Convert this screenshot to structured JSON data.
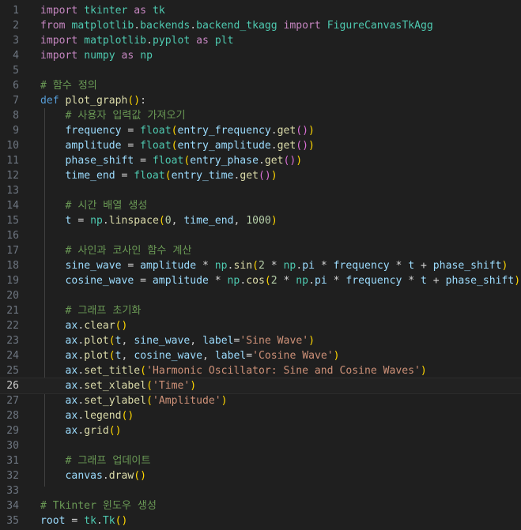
{
  "editor": {
    "language": "python",
    "current_line": 26,
    "colors": {
      "background": "#1f1f1f",
      "line_number": "#6e7681",
      "keyword_import": "#c586c0",
      "keyword_def": "#569cd6",
      "function": "#dcdcaa",
      "variable": "#9cdcfe",
      "module": "#4ec9b0",
      "comment": "#6a9955",
      "number": "#b5cea8",
      "string": "#ce9178",
      "bracket_1": "#ffd700",
      "bracket_2": "#da70d6",
      "bracket_3": "#179fff"
    },
    "lines": [
      {
        "n": "1",
        "tokens": [
          [
            "import",
            "kw"
          ],
          [
            " ",
            ""
          ],
          [
            "tkinter",
            "cls"
          ],
          [
            " ",
            ""
          ],
          [
            "as",
            "kw"
          ],
          [
            " ",
            ""
          ],
          [
            "tk",
            "cls"
          ]
        ]
      },
      {
        "n": "2",
        "tokens": [
          [
            "from",
            "kw"
          ],
          [
            " ",
            ""
          ],
          [
            "matplotlib",
            "cls"
          ],
          [
            ".",
            ""
          ],
          [
            "backends",
            "cls"
          ],
          [
            ".",
            ""
          ],
          [
            "backend_tkagg",
            "cls"
          ],
          [
            " ",
            ""
          ],
          [
            "import",
            "kw"
          ],
          [
            " ",
            ""
          ],
          [
            "FigureCanvasTkAgg",
            "cls"
          ]
        ]
      },
      {
        "n": "3",
        "tokens": [
          [
            "import",
            "kw"
          ],
          [
            " ",
            ""
          ],
          [
            "matplotlib",
            "cls"
          ],
          [
            ".",
            ""
          ],
          [
            "pyplot",
            "cls"
          ],
          [
            " ",
            ""
          ],
          [
            "as",
            "kw"
          ],
          [
            " ",
            ""
          ],
          [
            "plt",
            "cls"
          ]
        ]
      },
      {
        "n": "4",
        "tokens": [
          [
            "import",
            "kw"
          ],
          [
            " ",
            ""
          ],
          [
            "numpy",
            "cls"
          ],
          [
            " ",
            ""
          ],
          [
            "as",
            "kw"
          ],
          [
            " ",
            ""
          ],
          [
            "np",
            "cls"
          ]
        ]
      },
      {
        "n": "5",
        "tokens": []
      },
      {
        "n": "6",
        "tokens": [
          [
            "# 함수 정의",
            "cm"
          ]
        ]
      },
      {
        "n": "7",
        "tokens": [
          [
            "def",
            "def"
          ],
          [
            " ",
            ""
          ],
          [
            "plot_graph",
            "fn"
          ],
          [
            "(",
            "p1"
          ],
          [
            ")",
            "p1"
          ],
          [
            ":",
            ""
          ]
        ]
      },
      {
        "n": "8",
        "tokens": [
          [
            "    ",
            ""
          ],
          [
            "# 사용자 입력값 가져오기",
            "cm"
          ]
        ]
      },
      {
        "n": "9",
        "tokens": [
          [
            "    ",
            ""
          ],
          [
            "frequency",
            "var"
          ],
          [
            " = ",
            "op"
          ],
          [
            "float",
            "cls"
          ],
          [
            "(",
            "p1"
          ],
          [
            "entry_frequency",
            "var"
          ],
          [
            ".",
            ""
          ],
          [
            "get",
            "fn"
          ],
          [
            "()",
            "p2"
          ],
          [
            ")",
            "p1"
          ]
        ]
      },
      {
        "n": "10",
        "tokens": [
          [
            "    ",
            ""
          ],
          [
            "amplitude",
            "var"
          ],
          [
            " = ",
            "op"
          ],
          [
            "float",
            "cls"
          ],
          [
            "(",
            "p1"
          ],
          [
            "entry_amplitude",
            "var"
          ],
          [
            ".",
            ""
          ],
          [
            "get",
            "fn"
          ],
          [
            "()",
            "p2"
          ],
          [
            ")",
            "p1"
          ]
        ]
      },
      {
        "n": "11",
        "tokens": [
          [
            "    ",
            ""
          ],
          [
            "phase_shift",
            "var"
          ],
          [
            " = ",
            "op"
          ],
          [
            "float",
            "cls"
          ],
          [
            "(",
            "p1"
          ],
          [
            "entry_phase",
            "var"
          ],
          [
            ".",
            ""
          ],
          [
            "get",
            "fn"
          ],
          [
            "()",
            "p2"
          ],
          [
            ")",
            "p1"
          ]
        ]
      },
      {
        "n": "12",
        "tokens": [
          [
            "    ",
            ""
          ],
          [
            "time_end",
            "var"
          ],
          [
            " = ",
            "op"
          ],
          [
            "float",
            "cls"
          ],
          [
            "(",
            "p1"
          ],
          [
            "entry_time",
            "var"
          ],
          [
            ".",
            ""
          ],
          [
            "get",
            "fn"
          ],
          [
            "()",
            "p2"
          ],
          [
            ")",
            "p1"
          ]
        ]
      },
      {
        "n": "13",
        "tokens": []
      },
      {
        "n": "14",
        "tokens": [
          [
            "    ",
            ""
          ],
          [
            "# 시간 배열 생성",
            "cm"
          ]
        ]
      },
      {
        "n": "15",
        "tokens": [
          [
            "    ",
            ""
          ],
          [
            "t",
            "var"
          ],
          [
            " = ",
            "op"
          ],
          [
            "np",
            "cls"
          ],
          [
            ".",
            ""
          ],
          [
            "linspace",
            "fn"
          ],
          [
            "(",
            "p1"
          ],
          [
            "0",
            "num"
          ],
          [
            ", ",
            ""
          ],
          [
            "time_end",
            "var"
          ],
          [
            ", ",
            ""
          ],
          [
            "1000",
            "num"
          ],
          [
            ")",
            "p1"
          ]
        ]
      },
      {
        "n": "16",
        "tokens": []
      },
      {
        "n": "17",
        "tokens": [
          [
            "    ",
            ""
          ],
          [
            "# 사인과 코사인 함수 계산",
            "cm"
          ]
        ]
      },
      {
        "n": "18",
        "tokens": [
          [
            "    ",
            ""
          ],
          [
            "sine_wave",
            "var"
          ],
          [
            " = ",
            "op"
          ],
          [
            "amplitude",
            "var"
          ],
          [
            " * ",
            "op"
          ],
          [
            "np",
            "cls"
          ],
          [
            ".",
            ""
          ],
          [
            "sin",
            "fn"
          ],
          [
            "(",
            "p1"
          ],
          [
            "2",
            "num"
          ],
          [
            " * ",
            "op"
          ],
          [
            "np",
            "cls"
          ],
          [
            ".",
            ""
          ],
          [
            "pi",
            "var"
          ],
          [
            " * ",
            "op"
          ],
          [
            "frequency",
            "var"
          ],
          [
            " * ",
            "op"
          ],
          [
            "t",
            "var"
          ],
          [
            " + ",
            "op"
          ],
          [
            "phase_shift",
            "var"
          ],
          [
            ")",
            "p1"
          ]
        ]
      },
      {
        "n": "19",
        "tokens": [
          [
            "    ",
            ""
          ],
          [
            "cosine_wave",
            "var"
          ],
          [
            " = ",
            "op"
          ],
          [
            "amplitude",
            "var"
          ],
          [
            " * ",
            "op"
          ],
          [
            "np",
            "cls"
          ],
          [
            ".",
            ""
          ],
          [
            "cos",
            "fn"
          ],
          [
            "(",
            "p1"
          ],
          [
            "2",
            "num"
          ],
          [
            " * ",
            "op"
          ],
          [
            "np",
            "cls"
          ],
          [
            ".",
            ""
          ],
          [
            "pi",
            "var"
          ],
          [
            " * ",
            "op"
          ],
          [
            "frequency",
            "var"
          ],
          [
            " * ",
            "op"
          ],
          [
            "t",
            "var"
          ],
          [
            " + ",
            "op"
          ],
          [
            "phase_shift",
            "var"
          ],
          [
            ")",
            "p1"
          ]
        ]
      },
      {
        "n": "20",
        "tokens": []
      },
      {
        "n": "21",
        "tokens": [
          [
            "    ",
            ""
          ],
          [
            "# 그래프 초기화",
            "cm"
          ]
        ]
      },
      {
        "n": "22",
        "tokens": [
          [
            "    ",
            ""
          ],
          [
            "ax",
            "var"
          ],
          [
            ".",
            ""
          ],
          [
            "clear",
            "fn"
          ],
          [
            "()",
            "p1"
          ]
        ]
      },
      {
        "n": "23",
        "tokens": [
          [
            "    ",
            ""
          ],
          [
            "ax",
            "var"
          ],
          [
            ".",
            ""
          ],
          [
            "plot",
            "fn"
          ],
          [
            "(",
            "p1"
          ],
          [
            "t",
            "var"
          ],
          [
            ", ",
            ""
          ],
          [
            "sine_wave",
            "var"
          ],
          [
            ", ",
            ""
          ],
          [
            "label",
            "var"
          ],
          [
            "=",
            "op"
          ],
          [
            "'Sine Wave'",
            "str"
          ],
          [
            ")",
            "p1"
          ]
        ]
      },
      {
        "n": "24",
        "tokens": [
          [
            "    ",
            ""
          ],
          [
            "ax",
            "var"
          ],
          [
            ".",
            ""
          ],
          [
            "plot",
            "fn"
          ],
          [
            "(",
            "p1"
          ],
          [
            "t",
            "var"
          ],
          [
            ", ",
            ""
          ],
          [
            "cosine_wave",
            "var"
          ],
          [
            ", ",
            ""
          ],
          [
            "label",
            "var"
          ],
          [
            "=",
            "op"
          ],
          [
            "'Cosine Wave'",
            "str"
          ],
          [
            ")",
            "p1"
          ]
        ]
      },
      {
        "n": "25",
        "tokens": [
          [
            "    ",
            ""
          ],
          [
            "ax",
            "var"
          ],
          [
            ".",
            ""
          ],
          [
            "set_title",
            "fn"
          ],
          [
            "(",
            "p1"
          ],
          [
            "'Harmonic Oscillator: Sine and Cosine Waves'",
            "str"
          ],
          [
            ")",
            "p1"
          ]
        ]
      },
      {
        "n": "26",
        "tokens": [
          [
            "    ",
            ""
          ],
          [
            "ax",
            "var"
          ],
          [
            ".",
            ""
          ],
          [
            "set_xlabel",
            "fn"
          ],
          [
            "(",
            "p1"
          ],
          [
            "'Time'",
            "str"
          ],
          [
            ")",
            "p1"
          ]
        ]
      },
      {
        "n": "27",
        "tokens": [
          [
            "    ",
            ""
          ],
          [
            "ax",
            "var"
          ],
          [
            ".",
            ""
          ],
          [
            "set_ylabel",
            "fn"
          ],
          [
            "(",
            "p1"
          ],
          [
            "'Amplitude'",
            "str"
          ],
          [
            ")",
            "p1"
          ]
        ]
      },
      {
        "n": "28",
        "tokens": [
          [
            "    ",
            ""
          ],
          [
            "ax",
            "var"
          ],
          [
            ".",
            ""
          ],
          [
            "legend",
            "fn"
          ],
          [
            "()",
            "p1"
          ]
        ]
      },
      {
        "n": "29",
        "tokens": [
          [
            "    ",
            ""
          ],
          [
            "ax",
            "var"
          ],
          [
            ".",
            ""
          ],
          [
            "grid",
            "fn"
          ],
          [
            "()",
            "p1"
          ]
        ]
      },
      {
        "n": "30",
        "tokens": []
      },
      {
        "n": "31",
        "tokens": [
          [
            "    ",
            ""
          ],
          [
            "# 그래프 업데이트",
            "cm"
          ]
        ]
      },
      {
        "n": "32",
        "tokens": [
          [
            "    ",
            ""
          ],
          [
            "canvas",
            "var"
          ],
          [
            ".",
            ""
          ],
          [
            "draw",
            "fn"
          ],
          [
            "()",
            "p1"
          ]
        ]
      },
      {
        "n": "33",
        "tokens": []
      },
      {
        "n": "34",
        "tokens": [
          [
            "# Tkinter 윈도우 생성",
            "cm"
          ]
        ]
      },
      {
        "n": "35",
        "tokens": [
          [
            "root",
            "var"
          ],
          [
            " = ",
            "op"
          ],
          [
            "tk",
            "cls"
          ],
          [
            ".",
            ""
          ],
          [
            "Tk",
            "cls"
          ],
          [
            "()",
            "p1"
          ]
        ]
      }
    ]
  }
}
